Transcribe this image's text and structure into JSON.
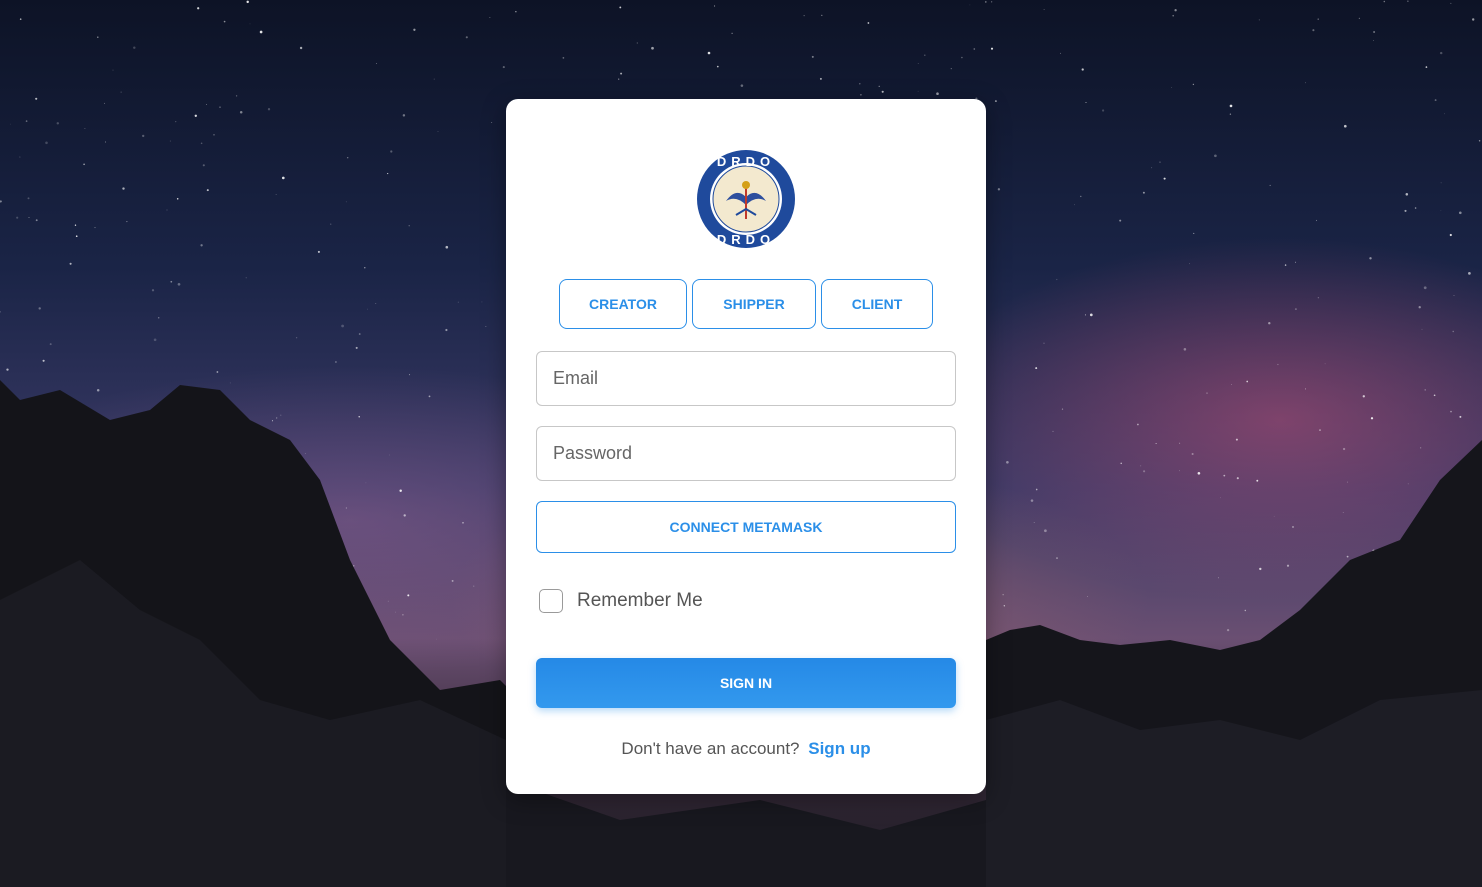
{
  "logo": {
    "name": "drdo-logo",
    "top_text": "DRDO",
    "bottom_text": "DRDO",
    "ring_color": "#1f4a9c"
  },
  "roles": {
    "creator": "CREATOR",
    "shipper": "SHIPPER",
    "client": "CLIENT"
  },
  "form": {
    "email_placeholder": "Email",
    "password_placeholder": "Password",
    "email_value": "",
    "password_value": "",
    "metamask_label": "CONNECT METAMASK",
    "remember_label": "Remember Me",
    "remember_checked": false,
    "signin_label": "SIGN IN"
  },
  "footer": {
    "prompt": "Don't have an account?",
    "signup_label": "Sign up"
  },
  "colors": {
    "accent": "#2b8fe8",
    "card_bg": "#ffffff"
  }
}
